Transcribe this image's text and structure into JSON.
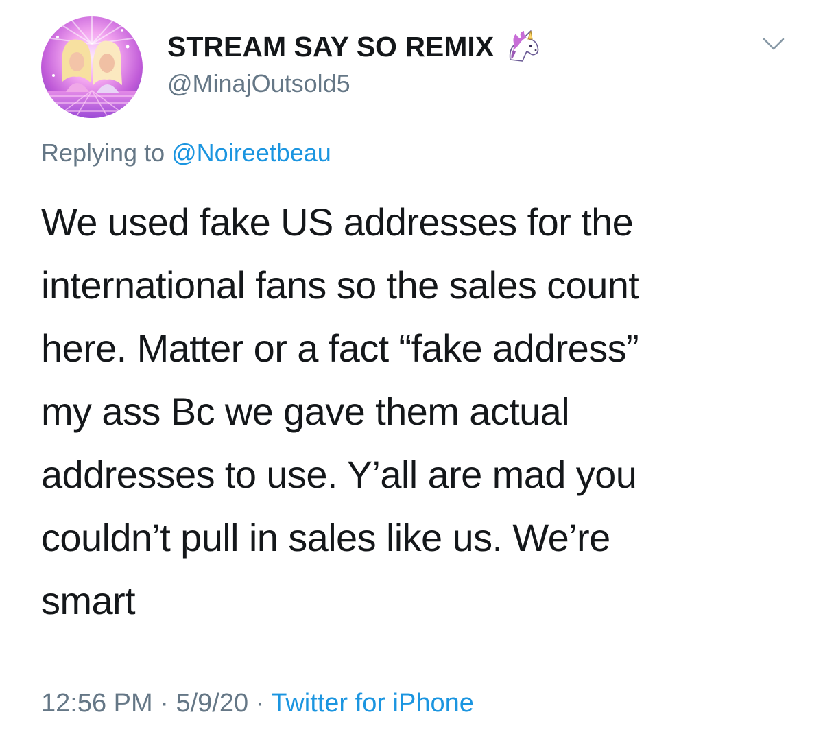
{
  "author": {
    "display_name": "STREAM SAY SO REMIX",
    "emoji_icon": "unicorn-icon",
    "handle": "@MinajOutsold5"
  },
  "reply": {
    "prefix": "Replying to",
    "mention": "@Noireetbeau"
  },
  "tweet": {
    "lines": [
      "We used fake US addresses for the",
      "international fans so the sales count",
      "here. Matter or a fact “fake address”",
      "my ass Bc we gave them actual",
      "addresses to use. Y’all are mad you",
      "couldn’t pull in sales like us. We’re",
      "smart"
    ]
  },
  "meta": {
    "time": "12:56 PM",
    "separator": "·",
    "date": "5/9/20",
    "source": "Twitter for iPhone"
  },
  "colors": {
    "text": "#14171a",
    "secondary": "#657786",
    "link": "#1b95e0"
  }
}
